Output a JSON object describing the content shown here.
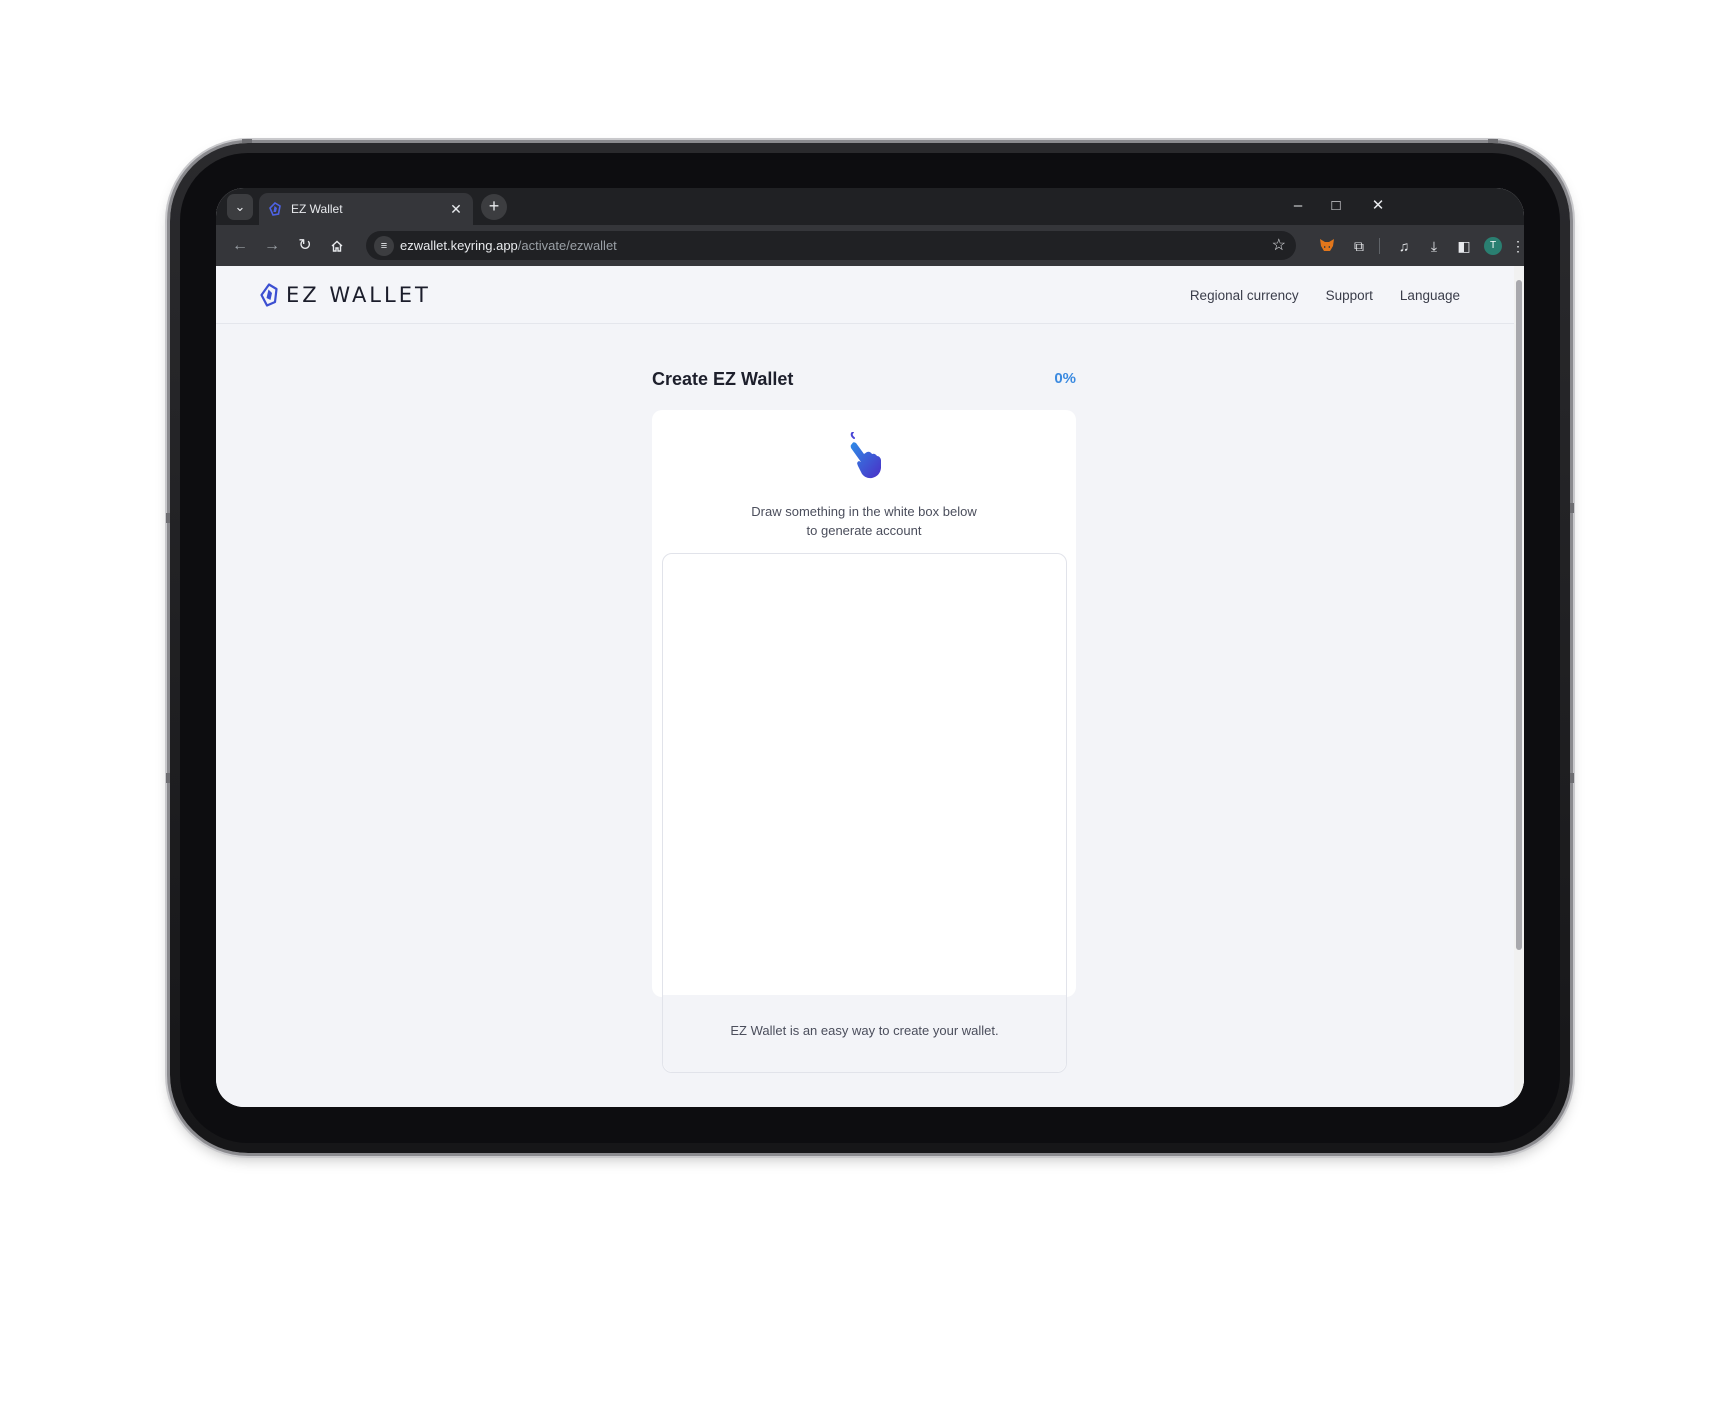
{
  "browser": {
    "tab_title": "EZ Wallet",
    "tab_list_icon": "chevron-down-icon",
    "new_tab_icon": "plus-icon",
    "close_tab_icon": "close-icon",
    "url_host": "ezwallet.keyring.app",
    "url_path": "/activate/ezwallet",
    "window_controls": [
      "minimize-icon",
      "maximize-icon",
      "close-window-icon"
    ],
    "profile_initial": "T"
  },
  "header": {
    "logo_text": "EZ WALLET",
    "nav": {
      "regional_currency": "Regional currency",
      "support": "Support",
      "language": "Language"
    }
  },
  "main": {
    "title": "Create EZ Wallet",
    "progress": "0%",
    "instruction_line1": "Draw something in the white box below",
    "instruction_line2": "to generate account",
    "footer_text": "EZ Wallet is an easy way to create your wallet."
  },
  "colors": {
    "brand_blue": "#3c4fd1",
    "progress_blue": "#3b8ae0",
    "page_bg": "#f3f4f8"
  }
}
